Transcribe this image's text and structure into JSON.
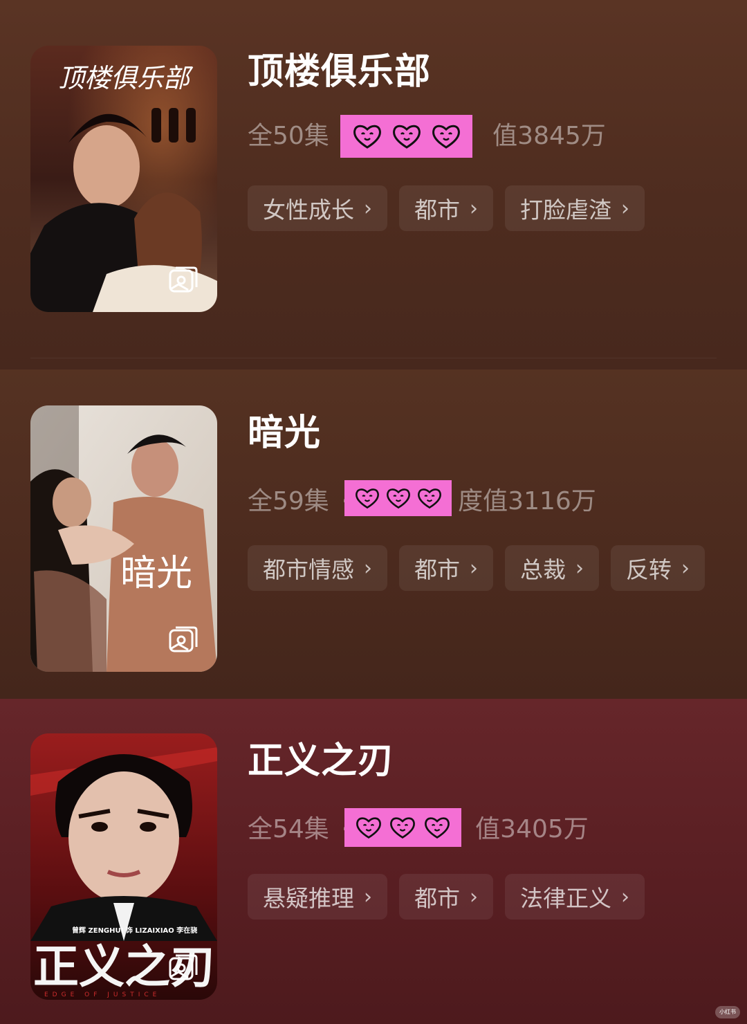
{
  "dramas": [
    {
      "title": "顶楼俱乐部",
      "episodes": "全50集",
      "separator": "·",
      "heat": "值3845万",
      "poster_title": "顶楼俱乐部",
      "tags": [
        {
          "label": "女性成长",
          "chevron": "›"
        },
        {
          "label": "都市",
          "chevron": "›"
        },
        {
          "label": "打脸虐渣",
          "chevron": "›"
        }
      ]
    },
    {
      "title": "暗光",
      "episodes": "全59集",
      "separator": "·",
      "heat": "度值3116万",
      "poster_title": "暗光",
      "tags": [
        {
          "label": "都市情感",
          "chevron": "›"
        },
        {
          "label": "都市",
          "chevron": "›"
        },
        {
          "label": "总裁",
          "chevron": "›"
        },
        {
          "label": "反转",
          "chevron": "›"
        }
      ]
    },
    {
      "title": "正义之刃",
      "episodes": "全54集",
      "separator": "·",
      "heat": "值3405万",
      "poster_title": "正义之刃",
      "poster_credit": "曾辉 ZENGHUI 饰 LIZAIXIAO 李在骁",
      "poster_subtitle": "EDGE OF JUSTICE",
      "tags": [
        {
          "label": "悬疑推理",
          "chevron": "›"
        },
        {
          "label": "都市",
          "chevron": "›"
        },
        {
          "label": "法律正义",
          "chevron": "›"
        }
      ]
    }
  ],
  "watermark": "小红书",
  "icons": {
    "gallery": "gallery-icon",
    "sticker": "heart-face-icon",
    "chevron": "chevron-right-icon"
  },
  "colors": {
    "sticker_pink": "#f46fd4",
    "title": "#ffffff"
  }
}
